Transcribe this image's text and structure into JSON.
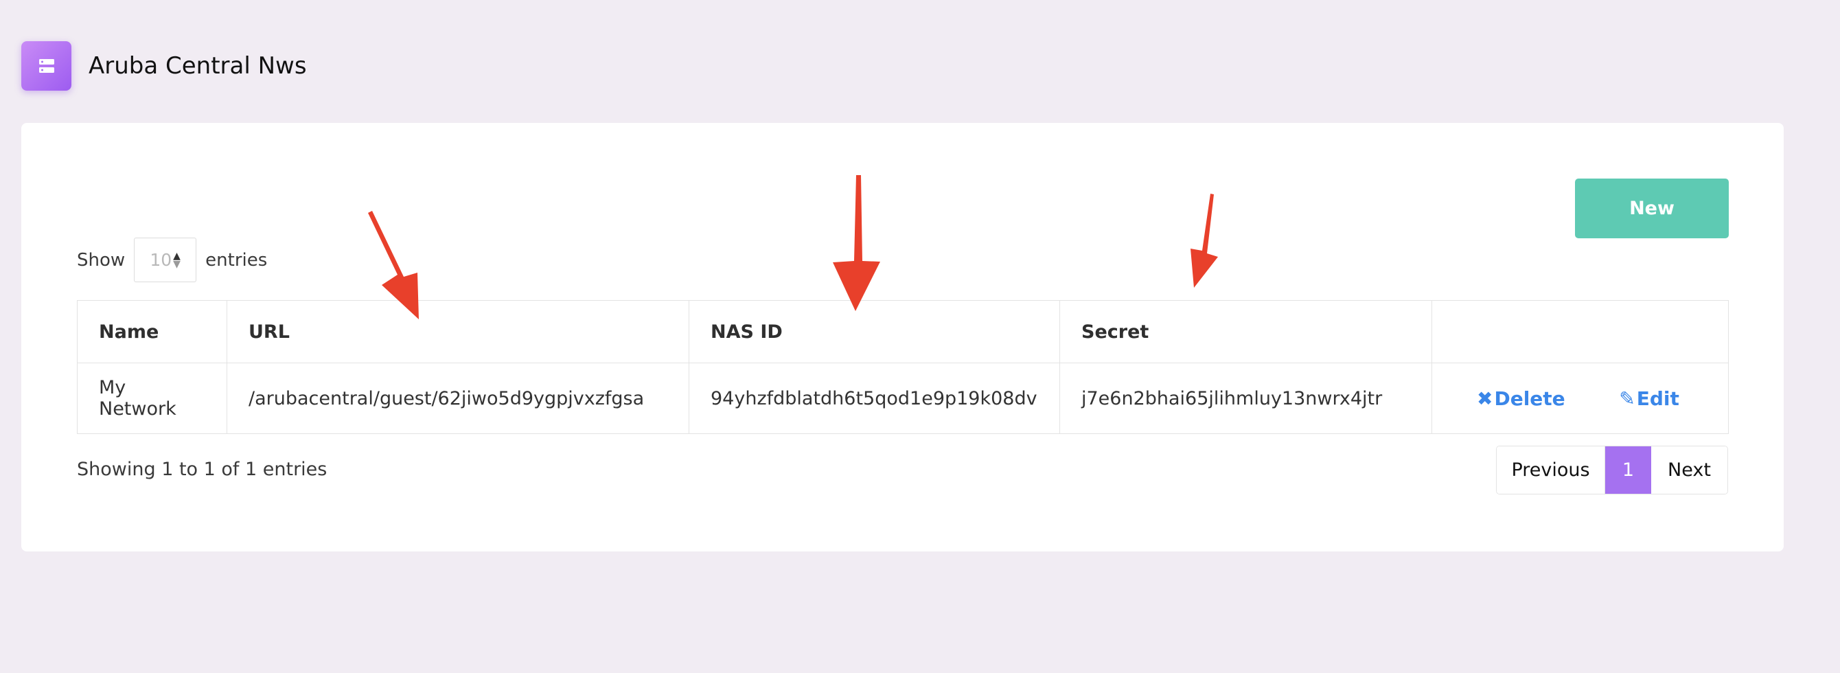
{
  "header": {
    "icon": "server-icon",
    "title": "Aruba Central Nws"
  },
  "toolbar": {
    "new_label": "New"
  },
  "length_control": {
    "prefix": "Show",
    "value": "10",
    "suffix": "entries"
  },
  "table": {
    "columns": [
      "Name",
      "URL",
      "NAS ID",
      "Secret",
      ""
    ],
    "rows": [
      {
        "name": "My Network",
        "url": "/arubacentral/guest/62jiwo5d9ygpjvxzfgsa",
        "nas_id": "94yhzfdblatdh6t5qod1e9p19k08dv",
        "secret": "j7e6n2bhai65jlihmluy13nwrx4jtr",
        "delete_label": "Delete",
        "edit_label": "Edit"
      }
    ]
  },
  "info": "Showing 1 to 1 of 1 entries",
  "pagination": {
    "previous": "Previous",
    "current": "1",
    "next": "Next"
  },
  "colors": {
    "accent": "#a571f0",
    "new_button": "#5ecab3",
    "action_link": "#3a86e8",
    "annotation_arrow": "#e8402b"
  }
}
